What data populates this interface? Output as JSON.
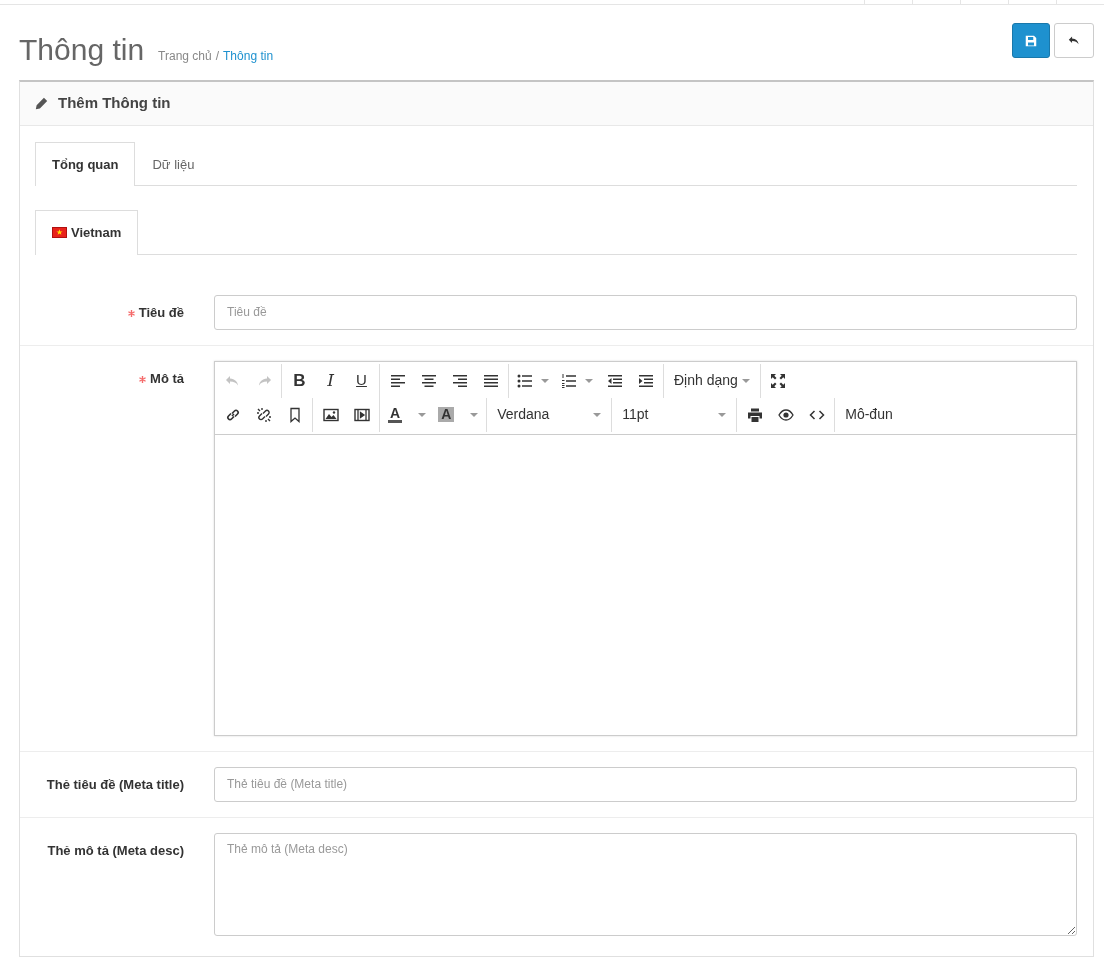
{
  "page": {
    "title": "Thông tin",
    "separator": "/",
    "breadcrumb": [
      {
        "label": "Trang chủ",
        "current": false
      },
      {
        "label": "Thông tin",
        "current": true
      }
    ]
  },
  "panel": {
    "title": "Thêm Thông tin"
  },
  "tabs": [
    {
      "label": "Tổng quan",
      "selected": true
    },
    {
      "label": "Dữ liệu",
      "selected": false
    }
  ],
  "language_tabs": [
    {
      "label": "Vietnam",
      "selected": true
    }
  ],
  "fields": [
    {
      "kind": "input",
      "label": "Tiêu đề",
      "required": true,
      "placeholder": "Tiêu đề"
    },
    {
      "kind": "editor",
      "label": "Mô tả",
      "required": true
    },
    {
      "kind": "input",
      "label": "Thẻ tiêu đề (Meta title)",
      "required": false,
      "placeholder": "Thẻ tiêu đề (Meta title)"
    },
    {
      "kind": "textarea",
      "label": "Thẻ mô tả (Meta desc)",
      "required": false,
      "placeholder": "Thẻ mô tả (Meta desc)"
    }
  ],
  "editor": {
    "undo": {
      "disabled": true
    },
    "redo": {
      "disabled": true
    },
    "style_buttons": [
      "B",
      "I",
      "U"
    ],
    "format_menu": "Định dạng",
    "color_buttons": [
      {
        "kind": "forecolor",
        "glyph": "A"
      },
      {
        "kind": "backcolor",
        "glyph": "A"
      }
    ],
    "font": "Verdana",
    "font_size": "11pt",
    "module_menu": "Mô-đun"
  }
}
